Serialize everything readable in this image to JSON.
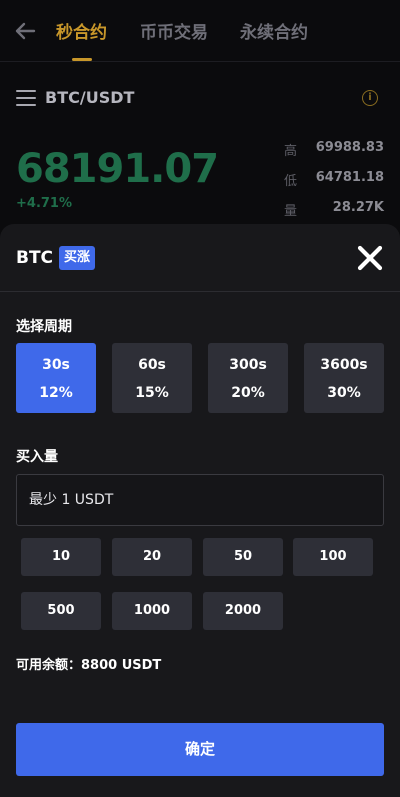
{
  "header": {
    "tabs": [
      {
        "label": "秒合约"
      },
      {
        "label": "币币交易"
      },
      {
        "label": "永续合约"
      }
    ]
  },
  "pair": {
    "title": "BTC/USDT",
    "price": "68191.07",
    "change": "+4.71%",
    "stats": [
      {
        "label": "高",
        "value": "69988.83"
      },
      {
        "label": "低",
        "value": "64781.18"
      },
      {
        "label": "量",
        "value": "28.27K"
      }
    ]
  },
  "sheet": {
    "symbol": "BTC",
    "direction_label": "买涨",
    "period_title": "选择周期",
    "periods": [
      {
        "time": "30s",
        "rate": "12%",
        "selected": true
      },
      {
        "time": "60s",
        "rate": "15%",
        "selected": false
      },
      {
        "time": "300s",
        "rate": "20%",
        "selected": false
      },
      {
        "time": "3600s",
        "rate": "30%",
        "selected": false
      }
    ],
    "amount_title": "买入量",
    "amount_placeholder": "最少 1 USDT",
    "amounts": [
      "10",
      "20",
      "50",
      "100",
      "500",
      "1000",
      "2000"
    ],
    "balance_label": "可用余额：",
    "balance_value": "8800 USDT",
    "confirm_label": "确定"
  },
  "colors": {
    "accent": "#3f69ea",
    "gold": "#c8972a",
    "up_green": "#1f6e4a",
    "sheet_bg": "#18181b"
  },
  "icons": {
    "back": "arrow-left-icon",
    "menu": "hamburger-menu-icon",
    "info": "info-circle-icon",
    "close": "close-x-icon"
  }
}
